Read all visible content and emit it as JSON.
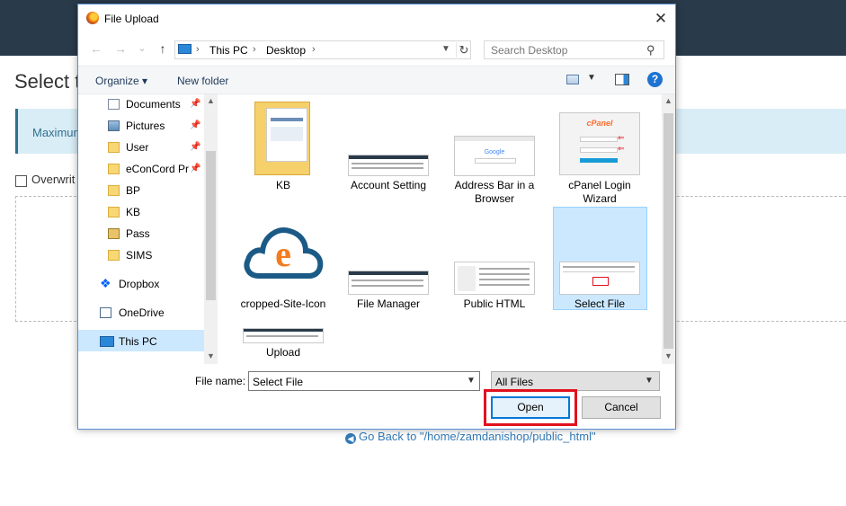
{
  "background": {
    "heading": "Select t",
    "info": "Maximum",
    "overwrite": "Overwrit",
    "go_back": "Go Back to \"/home/zamdanishop/public_html\""
  },
  "dialog": {
    "title": "File Upload",
    "close": "✕",
    "nav": {
      "back": "←",
      "forward": "→",
      "recent": "⌄",
      "up": "↑"
    },
    "breadcrumb": [
      "This PC",
      "Desktop"
    ],
    "breadcrumb_sep": "›",
    "search_placeholder": "Search Desktop",
    "organize": "Organize ▾",
    "new_folder": "New folder",
    "help": "?",
    "nav_items": [
      {
        "label": "Documents",
        "icon": "documents-icon",
        "pinned": true
      },
      {
        "label": "Pictures",
        "icon": "pictures-icon",
        "pinned": true
      },
      {
        "label": "User",
        "icon": "folder-icon",
        "pinned": true
      },
      {
        "label": "eConCord Pr",
        "icon": "folder-icon",
        "pinned": true
      },
      {
        "label": "BP",
        "icon": "folder-icon",
        "pinned": false
      },
      {
        "label": "KB",
        "icon": "folder-icon",
        "pinned": false
      },
      {
        "label": "Pass",
        "icon": "pass-icon",
        "pinned": false
      },
      {
        "label": "SIMS",
        "icon": "folder-icon",
        "pinned": false
      },
      {
        "label": "Dropbox",
        "icon": "dropbox-icon",
        "pinned": false
      },
      {
        "label": "OneDrive",
        "icon": "onedrive-icon",
        "pinned": false
      },
      {
        "label": "This PC",
        "icon": "this-pc-icon",
        "pinned": false,
        "selected": true
      }
    ],
    "files": [
      {
        "label": "KB"
      },
      {
        "label": "Account Setting"
      },
      {
        "label": "Address Bar in a Browser"
      },
      {
        "label": "cPanel Login Wizard"
      },
      {
        "label": "cropped-Site-Icon"
      },
      {
        "label": "File Manager"
      },
      {
        "label": "Public HTML"
      },
      {
        "label": "Select File",
        "selected": true
      },
      {
        "label": "Upload"
      }
    ],
    "file_name_label": "File name:",
    "file_name_value": "Select File",
    "file_type_value": "All Files",
    "open": "Open",
    "cancel": "Cancel",
    "thumb_texts": {
      "cpanel": "cPanel",
      "google": "Google",
      "cloud_letter": "e"
    }
  },
  "colors": {
    "highlight": "#e0121e",
    "selection": "#cce8ff",
    "accent": "#0078d7"
  }
}
